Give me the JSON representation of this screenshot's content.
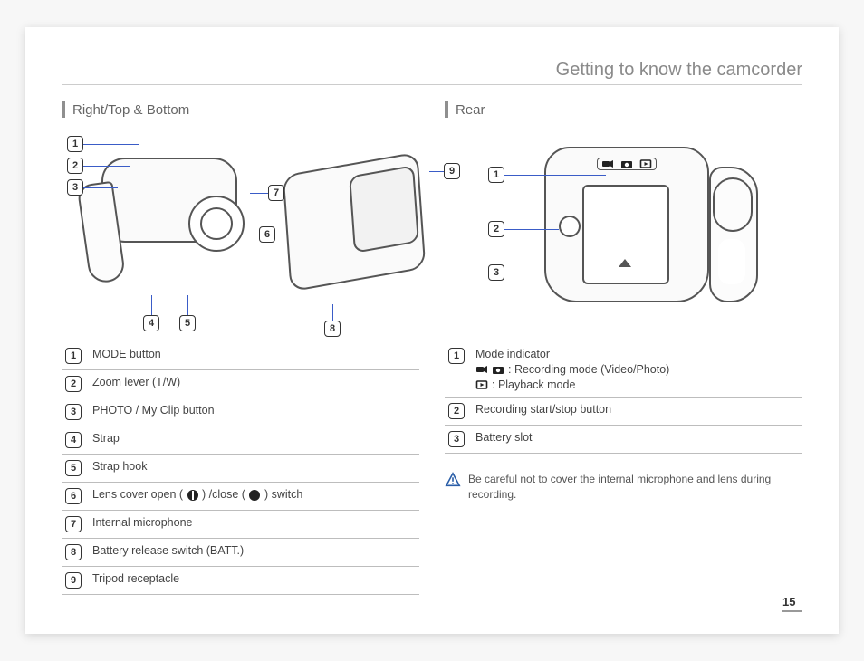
{
  "page_title": "Getting to know the camcorder",
  "page_number": "15",
  "left": {
    "heading": "Right/Top & Bottom",
    "callouts": [
      "1",
      "2",
      "3",
      "4",
      "5",
      "6",
      "7",
      "8",
      "9"
    ],
    "items": [
      {
        "n": "1",
        "label": "MODE button"
      },
      {
        "n": "2",
        "label": "Zoom lever (T/W)"
      },
      {
        "n": "3",
        "label": "PHOTO / My Clip button"
      },
      {
        "n": "4",
        "label": "Strap"
      },
      {
        "n": "5",
        "label": "Strap hook"
      },
      {
        "n": "6",
        "label_pre": "Lens cover open (",
        "label_mid": ") /close (",
        "label_post": ") switch"
      },
      {
        "n": "7",
        "label": "Internal microphone"
      },
      {
        "n": "8",
        "label": "Battery release switch (BATT.)"
      },
      {
        "n": "9",
        "label": "Tripod receptacle"
      }
    ]
  },
  "right": {
    "heading": "Rear",
    "callouts": [
      "1",
      "2",
      "3"
    ],
    "items": [
      {
        "n": "1",
        "label": "Mode indicator",
        "sub": [
          {
            "icons": [
              "video-camera-icon",
              "camera-icon"
            ],
            "text": ": Recording mode (Video/Photo)"
          },
          {
            "icons": [
              "playback-icon"
            ],
            "text": ": Playback mode"
          }
        ]
      },
      {
        "n": "2",
        "label": "Recording start/stop button"
      },
      {
        "n": "3",
        "label": "Battery slot"
      }
    ],
    "note": "Be careful not to cover the internal microphone and lens during recording."
  }
}
